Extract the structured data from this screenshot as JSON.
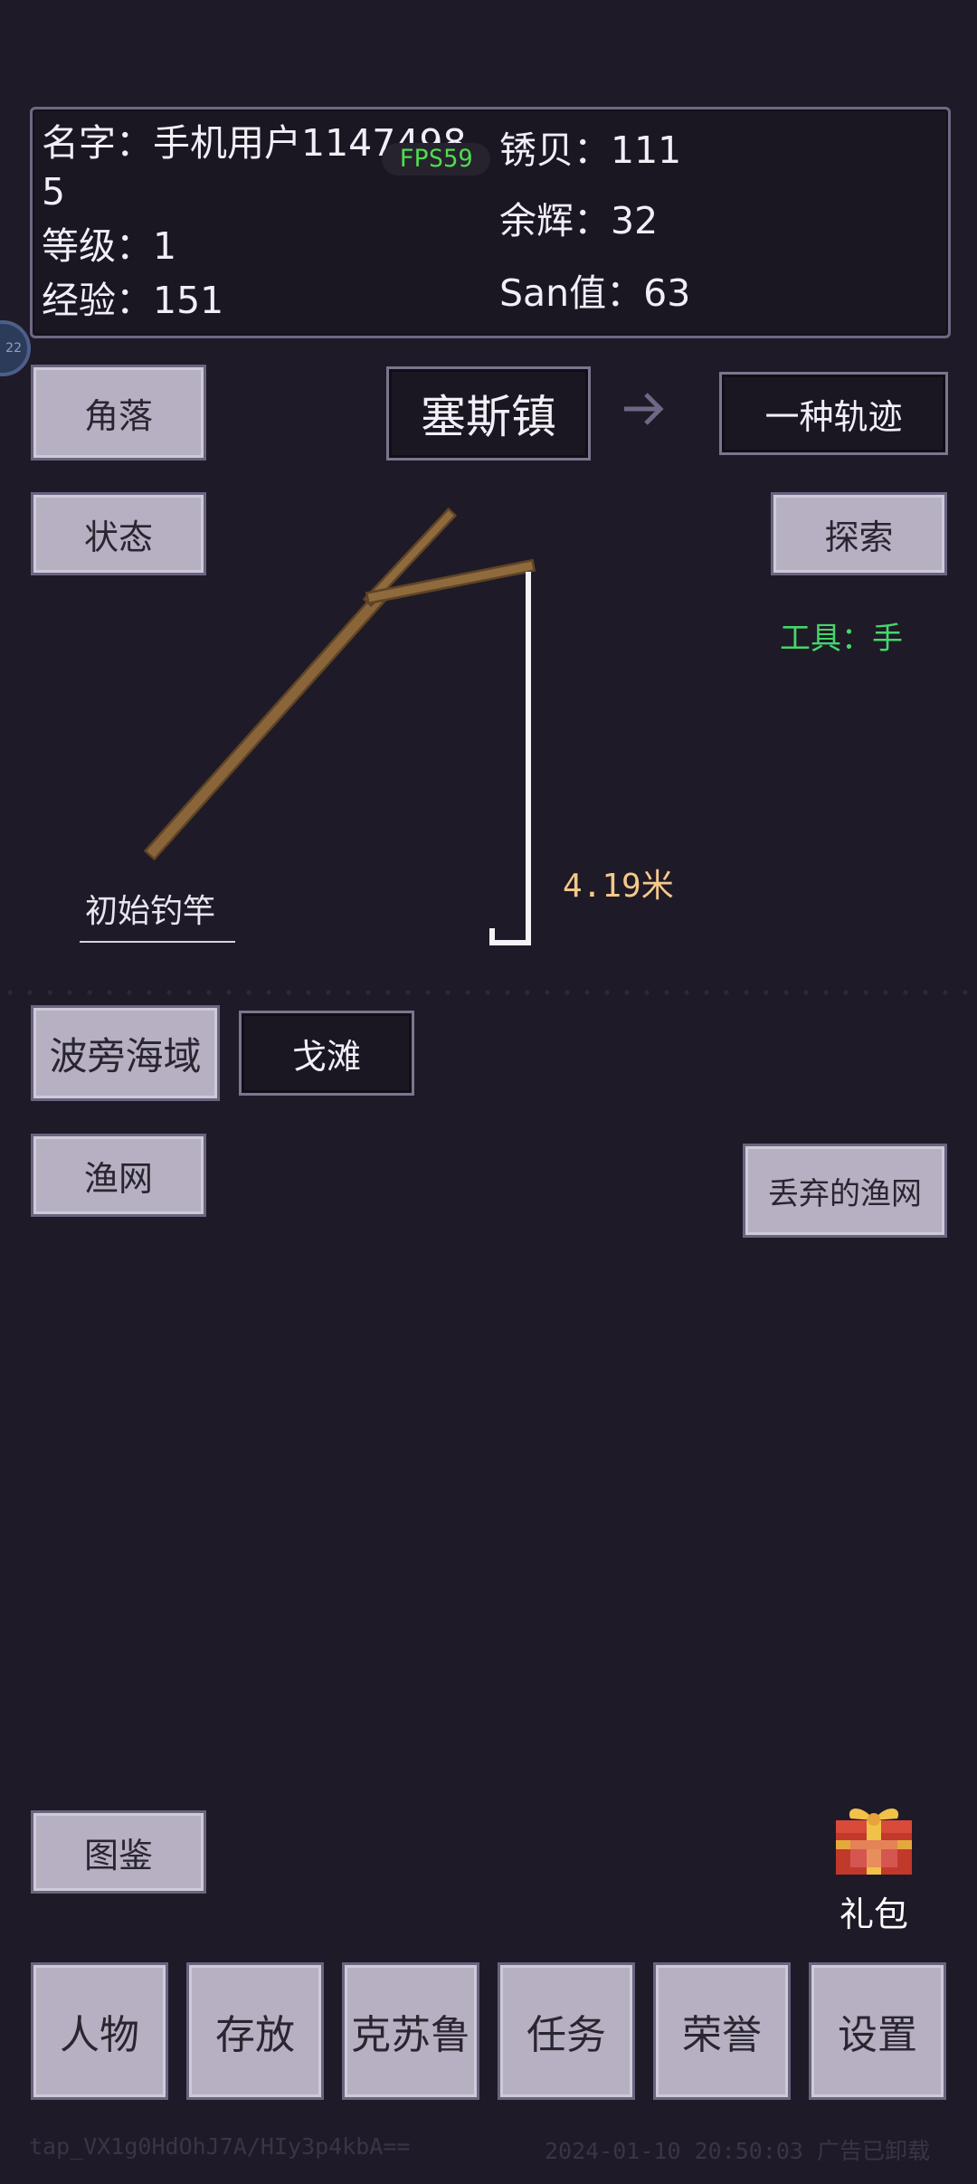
{
  "player": {
    "name_line1": "名字：手机用户1147498",
    "name_line2": "5",
    "level": "等级：1",
    "exp": "经验：151",
    "rust_shells": "锈贝：111",
    "afterglow": "余辉：32",
    "san": "San值：63",
    "fps": "FPS59"
  },
  "edge_badge": "22",
  "location": {
    "corner_button": "角落",
    "current_town": "塞斯镇",
    "arrow": "→",
    "next_destination": "一种轨迹",
    "status_button": "状态",
    "explore_button": "探索",
    "tool_label": "工具：手"
  },
  "fishing": {
    "rod_name": "初始钓竿",
    "depth": "4.19米"
  },
  "areas": {
    "sea_button": "波旁海域",
    "beach_button": "戈滩",
    "net_button": "渔网",
    "discarded_net_button": "丢弃的渔网"
  },
  "bottom": {
    "codex_button": "图鉴",
    "gift_label": "礼包",
    "nav": [
      "人物",
      "存放",
      "克苏鲁",
      "任务",
      "荣誉",
      "设置"
    ]
  },
  "footer": {
    "left": "tap_VX1g0HdOhJ7A/HIy3p4kbA==",
    "right": "2024-01-10 20:50:03  广告已卸载"
  },
  "colors": {
    "background": "#1f1a27",
    "button_light": "#b6b0c2",
    "tool_green": "#44d66a",
    "depth_orange": "#f4c98a",
    "rod_brown": "#8a6539"
  }
}
